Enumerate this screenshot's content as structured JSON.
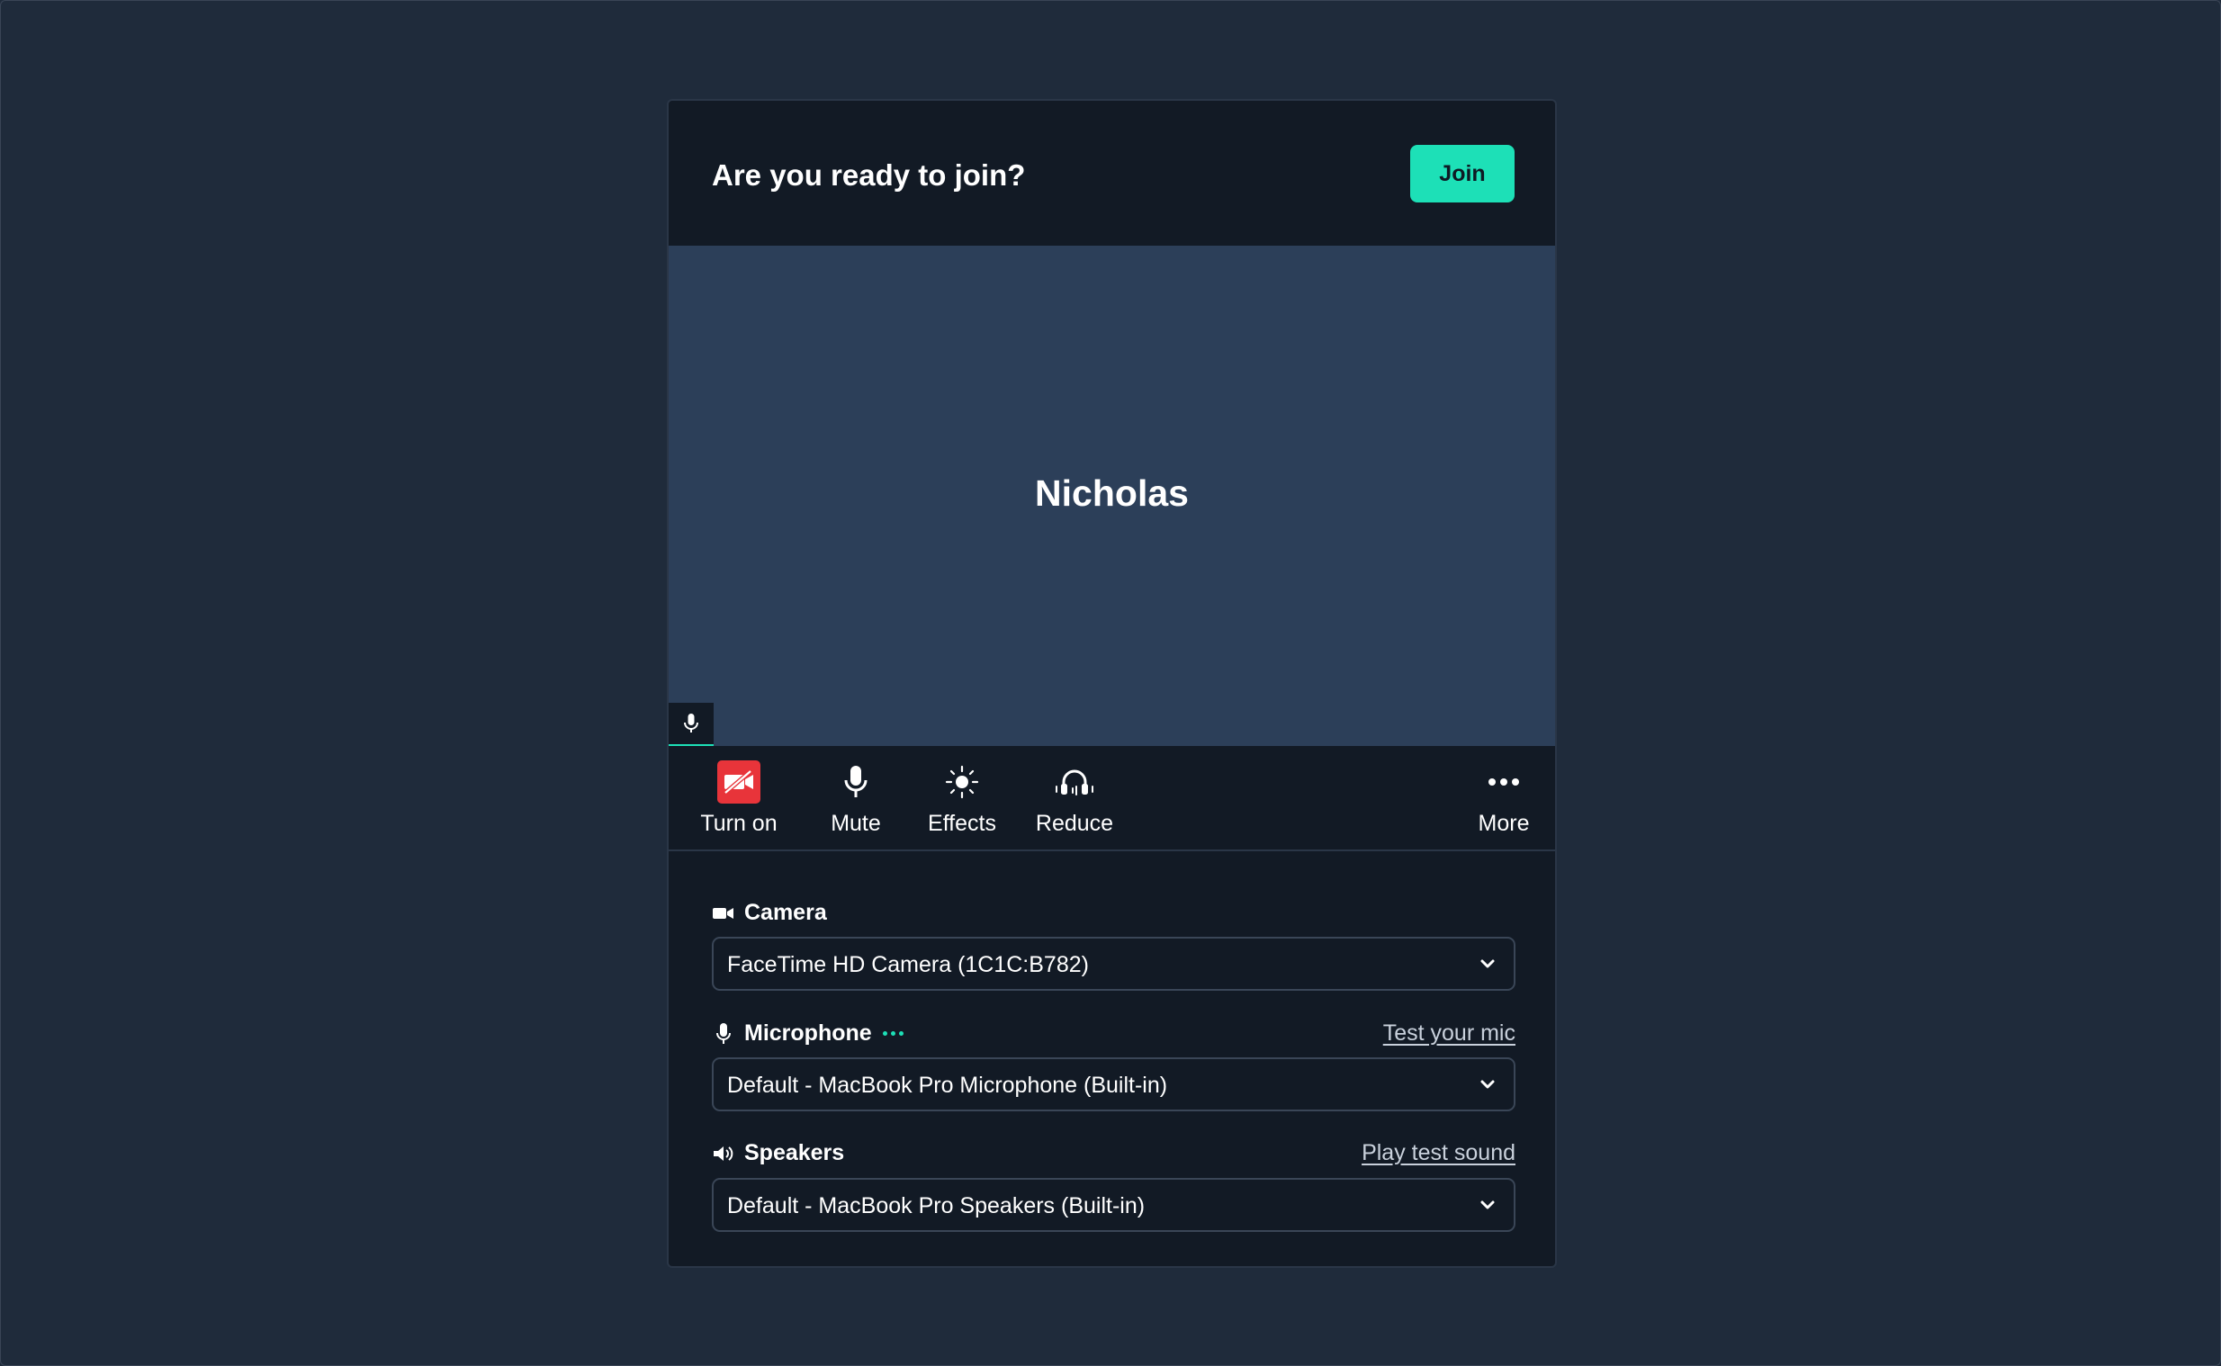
{
  "header": {
    "title": "Are you ready to join?",
    "join_label": "Join"
  },
  "preview": {
    "participant_name": "Nicholas",
    "mic_icon": "microphone-icon"
  },
  "controls": {
    "camera": {
      "label": "Turn on",
      "icon": "camera-off-icon",
      "accent": "#e8343a"
    },
    "mute": {
      "label": "Mute",
      "icon": "microphone-icon"
    },
    "effects": {
      "label": "Effects",
      "icon": "sun-sparkle-icon"
    },
    "reduce": {
      "label": "Reduce",
      "icon": "headphones-noise-icon"
    },
    "more": {
      "label": "More",
      "icon": "more-dots-icon"
    }
  },
  "settings": {
    "camera": {
      "label": "Camera",
      "icon": "video-camera-icon",
      "selected": "FaceTime HD Camera (1C1C:B782)"
    },
    "microphone": {
      "label": "Microphone",
      "icon": "microphone-icon",
      "link": "Test your mic",
      "selected": "Default - MacBook Pro Microphone (Built-in)"
    },
    "speakers": {
      "label": "Speakers",
      "icon": "speaker-icon",
      "link": "Play test sound",
      "selected": "Default - MacBook Pro Speakers (Built-in)"
    }
  },
  "colors": {
    "background": "#1f2b3b",
    "card": "#121a25",
    "preview": "#2c3f59",
    "accent": "#1de0b7",
    "danger": "#e8343a"
  }
}
